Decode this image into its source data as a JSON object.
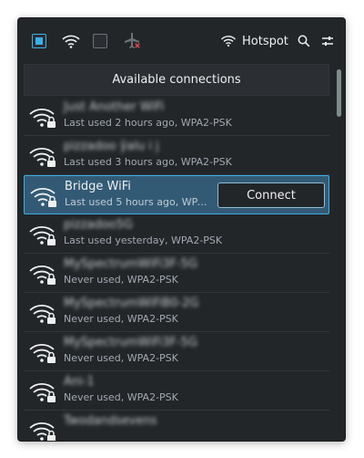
{
  "toolbar": {
    "wifi_toggle_checked": true,
    "mobile_toggle_checked": false,
    "hotspot_label": "Hotspot"
  },
  "header": {
    "title": "Available connections"
  },
  "connections": [
    {
      "name": "Just Another WiFi",
      "status": "Last used 2 hours ago, WPA2-PSK",
      "blurred": true
    },
    {
      "name": "pizzadoo ŷalu i j",
      "status": "Last used 3 hours ago, WPA2-PSK",
      "blurred": true
    },
    {
      "name": "Bridge WiFi",
      "status": "Last used 5 hours ago, WPA2-PSK",
      "blurred": false,
      "selected": true,
      "action": "Connect"
    },
    {
      "name": "pizzadoo5G",
      "status": "Last used yesterday, WPA2-PSK",
      "blurred": true
    },
    {
      "name": "MySpectrumWiFi3F-5G",
      "status": "Never used, WPA2-PSK",
      "blurred": true
    },
    {
      "name": "MySpectrumWiFiB0-2G",
      "status": "Never used, WPA2-PSK",
      "blurred": true
    },
    {
      "name": "MySpectrumWiFi3F-5G",
      "status": "Never used, WPA2-PSK",
      "blurred": true
    },
    {
      "name": "Ani-1",
      "status": "Never used, WPA2-PSK",
      "blurred": true
    },
    {
      "name": "Twodandsevens",
      "status": "",
      "blurred": true
    }
  ],
  "colors": {
    "background": "#232629",
    "accent": "#3daee9",
    "selected_row": "#335a75",
    "text": "#eff0f1",
    "subtext": "#a1a9b1",
    "airplane_mode_badge": "#da4453"
  },
  "icons": [
    "wifi-icon",
    "airplane-mode-off-icon",
    "hotspot-icon",
    "search-icon",
    "settings-icon",
    "wifi-secured-icon"
  ]
}
